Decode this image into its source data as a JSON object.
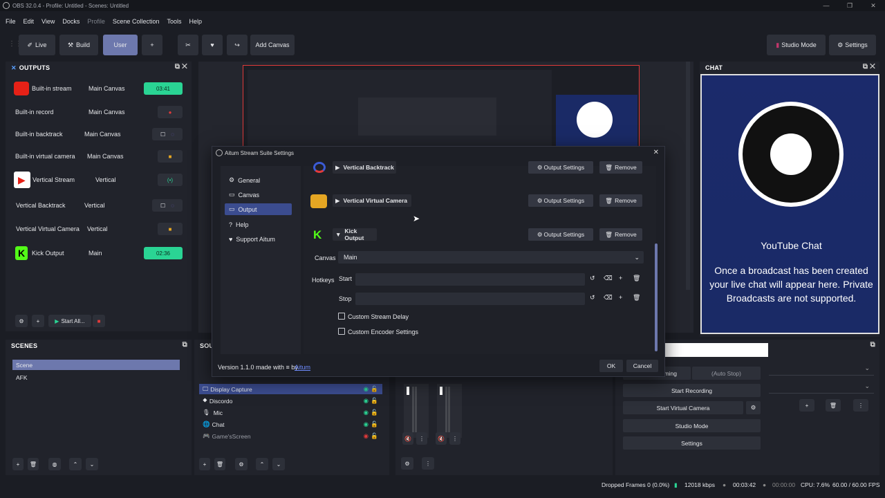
{
  "window": {
    "title": "OBS 32.0.4 - Profile: Untitled - Scenes: Untitled"
  },
  "menu": [
    "File",
    "Edit",
    "View",
    "Docks",
    "Profile",
    "Scene Collection",
    "Tools",
    "Help"
  ],
  "toolbar": {
    "live": "Live",
    "build": "Build",
    "user": "User",
    "plus": "+",
    "add_canvas": "Add Canvas",
    "studio_mode": "Studio Mode",
    "settings": "Settings"
  },
  "outputs": {
    "title": "OUTPUTS",
    "rows": [
      {
        "name": "Built-in stream",
        "canvas": "Main Canvas",
        "status": "03:41"
      },
      {
        "name": "Built-in record",
        "canvas": "Main Canvas"
      },
      {
        "name": "Built-in backtrack",
        "canvas": "Main Canvas"
      },
      {
        "name": "Built-in virtual camera",
        "canvas": "Main Canvas"
      },
      {
        "name": "Vertical Stream",
        "canvas": "Vertical"
      },
      {
        "name": "Vertical Backtrack",
        "canvas": "Vertical"
      },
      {
        "name": "Vertical Virtual Camera",
        "canvas": "Vertical"
      },
      {
        "name": "Kick Output",
        "canvas": "Main",
        "status": "02:36"
      }
    ],
    "start_all": "Start All..."
  },
  "chat": {
    "title": "CHAT",
    "heading": "YouTube Chat",
    "message": "Once a broadcast has been created your live chat will appear here. Private Broadcasts are not supported."
  },
  "dialog": {
    "title": "Aitum Stream Suite Settings",
    "nav": [
      "General",
      "Canvas",
      "Output",
      "Help",
      "Support Aitum"
    ],
    "outputs": [
      {
        "name": "Vertical Backtrack",
        "settings": "Output Settings",
        "remove": "Remove"
      },
      {
        "name": "Vertical Virtual Camera",
        "settings": "Output Settings",
        "remove": "Remove"
      },
      {
        "name": "Kick Output",
        "settings": "Output Settings",
        "remove": "Remove"
      }
    ],
    "canvas_label": "Canvas",
    "canvas_value": "Main",
    "hotkeys_label": "Hotkeys",
    "start_label": "Start",
    "stop_label": "Stop",
    "custom_delay": "Custom Stream Delay",
    "custom_encoder": "Custom Encoder Settings",
    "version": "Version 1.1.0 made with ≡ by",
    "author": "Aitum",
    "ok": "OK",
    "cancel": "Cancel"
  },
  "scenes": {
    "title": "SCENES",
    "items": [
      "Scene",
      "AFK"
    ]
  },
  "sources": {
    "title": "SOU",
    "items": [
      "Display Capture",
      "Discordo",
      "Mic",
      "Chat",
      "Game'sScreen"
    ]
  },
  "controls": {
    "auto_stop": "(Auto Stop)",
    "streaming": "ming",
    "start_recording": "Start Recording",
    "start_virtual_camera": "Start Virtual Camera",
    "studio_mode": "Studio Mode",
    "settings": "Settings"
  },
  "status": {
    "dropped": "Dropped Frames 0 (0.0%)",
    "bitrate": "12018 kbps",
    "stream_time": "00:03:42",
    "rec_time": "00:00:00",
    "cpu": "CPU: 7.6%",
    "fps": "60.00 / 60.00 FPS"
  },
  "colors": {
    "accent": "#6d78ad",
    "green": "#2ad494",
    "selected": "#3b4c8f",
    "chat_bg": "#1a2a66"
  }
}
